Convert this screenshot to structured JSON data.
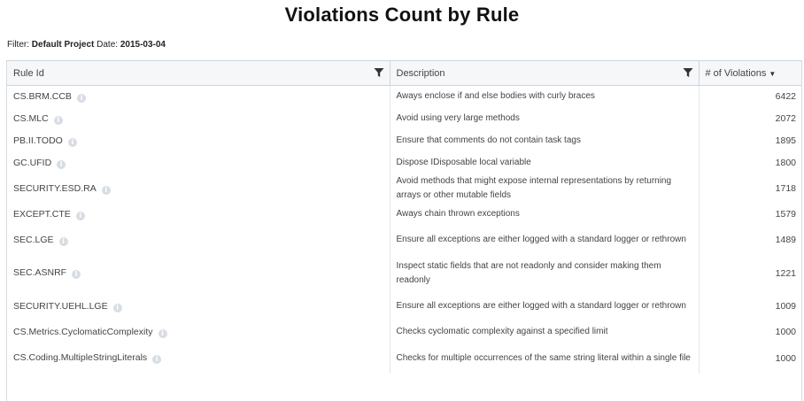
{
  "title": "Violations Count by Rule",
  "filter": {
    "label": "Filter:",
    "project": "Default Project",
    "date_label": "Date:",
    "date": "2015-03-04"
  },
  "columns": {
    "rule_id": "Rule Id",
    "description": "Description",
    "violations": "# of Violations"
  },
  "icons": {
    "filter": "funnel-icon",
    "sort": "sort-descending-icon",
    "info": "info-icon"
  },
  "colors": {
    "header_bg": "#f6f7f9",
    "border": "#cfd5db",
    "info_icon": "#d7dde3"
  },
  "rows": [
    {
      "rule": "CS.BRM.CCB",
      "desc": "Aways enclose if and else bodies with curly braces",
      "count": "6422"
    },
    {
      "rule": "CS.MLC",
      "desc": "Avoid using very large methods",
      "count": "2072"
    },
    {
      "rule": "PB.II.TODO",
      "desc": "Ensure that comments do not contain task tags",
      "count": "1895"
    },
    {
      "rule": "GC.UFID",
      "desc": "Dispose IDisposable local variable",
      "count": "1800"
    },
    {
      "rule": "SECURITY.ESD.RA",
      "desc": "Avoid methods that might expose internal representations by returning arrays or other mutable fields",
      "count": "1718"
    },
    {
      "rule": "EXCEPT.CTE",
      "desc": "Aways chain thrown exceptions",
      "count": "1579"
    },
    {
      "rule": "SEC.LGE",
      "desc": "Ensure all exceptions are either logged with a standard logger or rethrown",
      "count": "1489"
    },
    {
      "rule": "SEC.ASNRF",
      "desc": "Inspect static fields that are not readonly and consider making them readonly",
      "count": "1221"
    },
    {
      "rule": "SECURITY.UEHL.LGE",
      "desc": "Ensure all exceptions are either logged with a standard logger or rethrown",
      "count": "1009"
    },
    {
      "rule": "CS.Metrics.CyclomaticComplexity",
      "desc": "Checks cyclomatic complexity against a specified limit",
      "count": "1000"
    },
    {
      "rule": "CS.Coding.MultipleStringLiterals",
      "desc": "Checks for multiple occurrences of the same string literal within a single file",
      "count": "1000"
    }
  ]
}
